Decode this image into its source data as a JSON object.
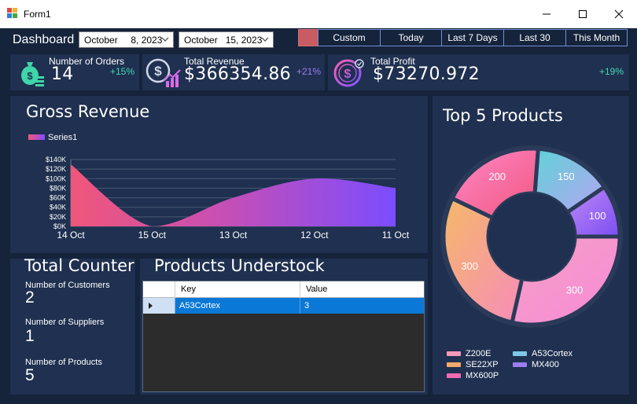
{
  "window": {
    "title": "Form1"
  },
  "header": {
    "dashboard_label": "Dashboard",
    "start_date": "October     8, 2023",
    "end_date": "October   15, 2023",
    "filters": [
      "Custom",
      "Today",
      "Last 7 Days",
      "Last 30",
      "This Month"
    ]
  },
  "kpis": [
    {
      "title": "Number of Orders",
      "value": "14",
      "change": "+15%",
      "icon": "money-bag-icon",
      "change_color": "#44d9b4"
    },
    {
      "title": "Total Revenue",
      "value": "$366354.86",
      "change": "+21%",
      "icon": "dollar-growth-icon",
      "change_color": "#9d7cf0"
    },
    {
      "title": "Total Profit",
      "value": "$73270.972",
      "change": "+19%",
      "icon": "dollar-coin-icon",
      "change_color": "#44d9b4"
    }
  ],
  "gross_revenue": {
    "title": "Gross Revenue",
    "legend": "Series1",
    "y_ticks": [
      "$140K",
      "$120K",
      "$100K",
      "$80K",
      "$60K",
      "$40K",
      "$20K",
      "$0K"
    ],
    "x_ticks": [
      "14 Oct",
      "15 Oct",
      "13 Oct",
      "12 Oct",
      "11 Oct"
    ]
  },
  "top_products": {
    "title": "Top 5 Products",
    "legend": [
      "Z200E",
      "A53Cortex",
      "SE22XP",
      "MX400",
      "MX600P"
    ]
  },
  "total_counter": {
    "title": "Total Counter",
    "items": [
      {
        "label": "Number of Customers",
        "value": "2"
      },
      {
        "label": "Number of Suppliers",
        "value": "1"
      },
      {
        "label": "Number of Products",
        "value": "5"
      }
    ]
  },
  "understock": {
    "title": "Products Understock",
    "columns": [
      "Key",
      "Value"
    ],
    "rows": [
      {
        "key": "A53Cortex",
        "value": "3"
      }
    ]
  },
  "chart_data": [
    {
      "type": "area",
      "title": "Gross Revenue",
      "series": [
        {
          "name": "Series1",
          "values": [
            130000,
            0,
            60000,
            100000,
            80000
          ]
        }
      ],
      "categories": [
        "14 Oct",
        "15 Oct",
        "13 Oct",
        "12 Oct",
        "11 Oct"
      ],
      "ylim": [
        0,
        140000
      ],
      "grid": true,
      "legend_position": "top-left",
      "colors": [
        "#f0567a",
        "#7b4dff"
      ]
    },
    {
      "type": "pie",
      "title": "Top 5 Products",
      "labels": [
        "MX600P",
        "Z200E",
        "A53Cortex",
        "MX400",
        "SE22XP"
      ],
      "values": [
        300,
        200,
        150,
        100,
        300
      ],
      "colors": [
        "#f2a0c8",
        "#f16bb0",
        "#7ec8e6",
        "#9b7cf2",
        "#f5a86b"
      ]
    }
  ]
}
